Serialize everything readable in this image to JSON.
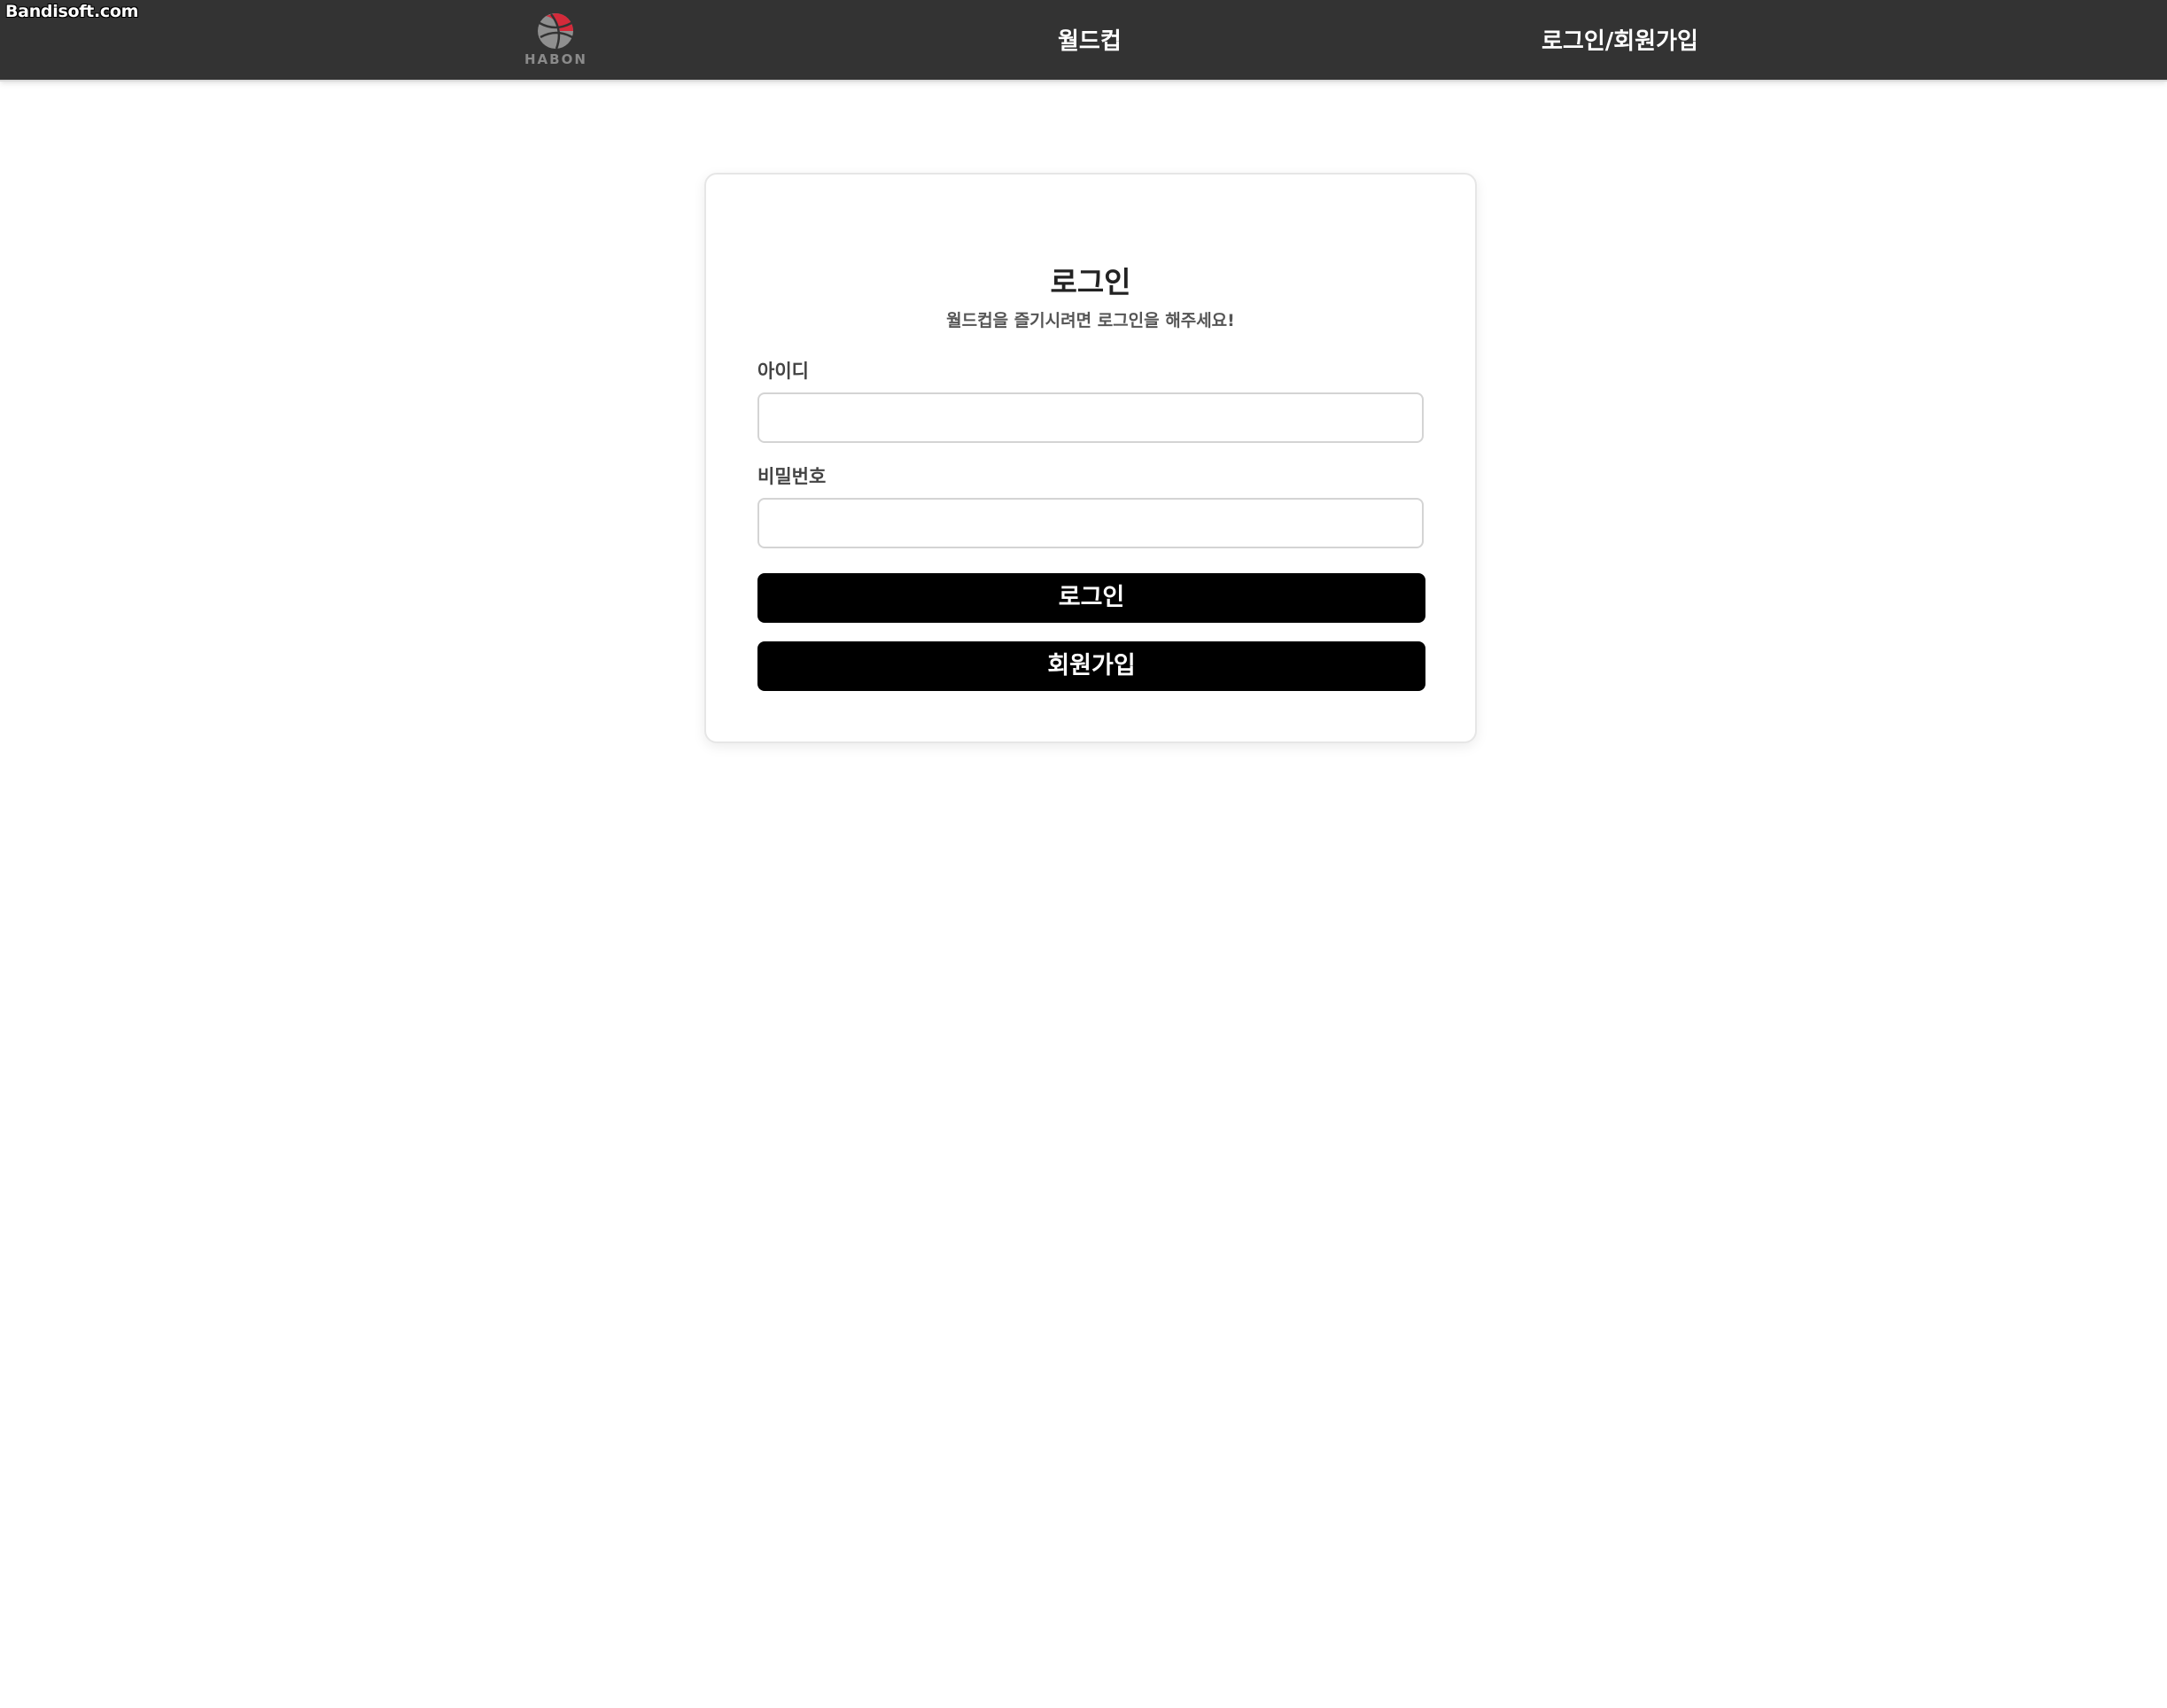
{
  "watermark": "Bandisoft.com",
  "header": {
    "logo_text": "HABON",
    "nav": {
      "worldcup_label": "월드컵",
      "auth_label": "로그인/회원가입"
    }
  },
  "login_card": {
    "title": "로그인",
    "subtitle": "월드컵을 즐기시려면 로그인을 해주세요!",
    "id_field": {
      "label": "아이디",
      "value": "",
      "placeholder": ""
    },
    "password_field": {
      "label": "비밀번호",
      "value": "",
      "placeholder": ""
    },
    "login_button_label": "로그인",
    "signup_button_label": "회원가입"
  },
  "colors": {
    "navbar_bg": "#333333",
    "button_bg": "#000000",
    "logo_accent": "#d42a3a"
  },
  "icons": {
    "logo": "basketball-logo-icon"
  }
}
